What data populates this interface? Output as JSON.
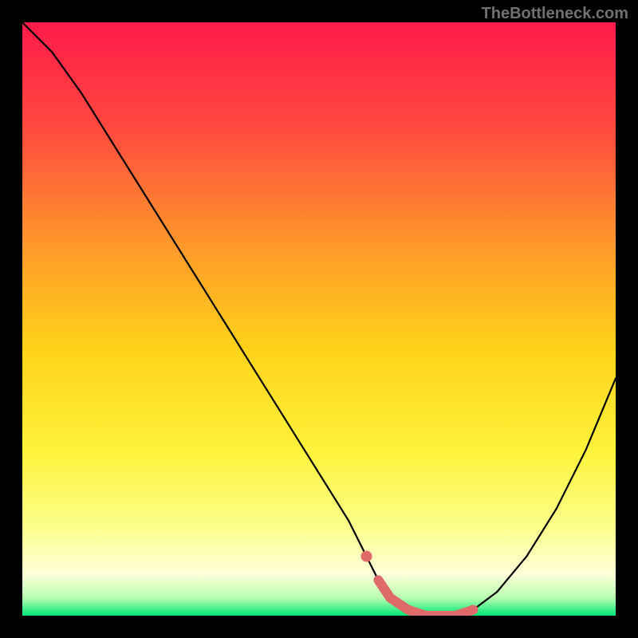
{
  "watermark": "TheBottleneck.com",
  "colors": {
    "page_bg": "#000000",
    "gradient_top": "#ff1a4a",
    "gradient_mid_upper": "#ff7a3a",
    "gradient_mid": "#ffe13a",
    "gradient_lower": "#faff66",
    "gradient_pale": "#fdffd0",
    "gradient_bottom": "#00e676",
    "curve": "#000000",
    "highlight": "#e06a6a",
    "watermark": "#707070"
  },
  "chart_data": {
    "type": "line",
    "title": "",
    "xlabel": "",
    "ylabel": "",
    "xlim": [
      0,
      100
    ],
    "ylim": [
      0,
      100
    ],
    "grid": false,
    "legend": false,
    "series": [
      {
        "name": "bottleneck-curve",
        "x": [
          0,
          5,
          10,
          15,
          20,
          25,
          30,
          35,
          40,
          45,
          50,
          55,
          58,
          60,
          62,
          65,
          68,
          70,
          73,
          76,
          80,
          85,
          90,
          95,
          100
        ],
        "values": [
          100,
          95,
          88,
          80,
          72,
          64,
          56,
          48,
          40,
          32,
          24,
          16,
          10,
          6,
          3,
          1,
          0,
          0,
          0,
          1,
          4,
          10,
          18,
          28,
          40
        ]
      },
      {
        "name": "highlight-segment",
        "x": [
          58,
          60,
          62,
          65,
          68,
          70,
          73,
          76
        ],
        "values": [
          10,
          6,
          3,
          1,
          0,
          0,
          0,
          1
        ]
      }
    ],
    "annotations": []
  }
}
